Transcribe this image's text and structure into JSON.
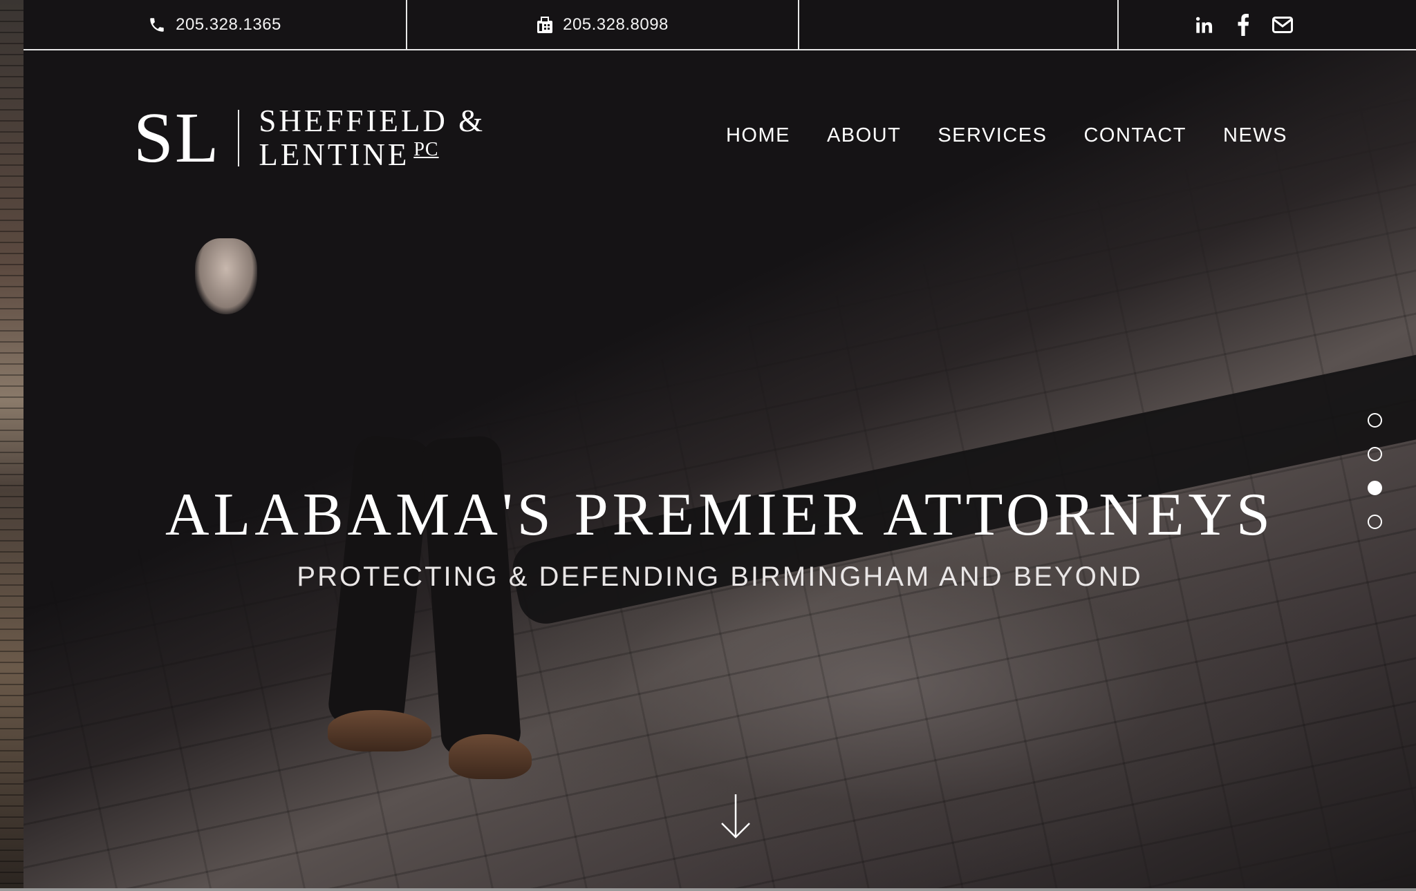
{
  "topbar": {
    "phone": "205.328.1365",
    "fax": "205.328.8098",
    "social": [
      "linkedin-icon",
      "facebook-icon",
      "envelope-icon"
    ]
  },
  "logo": {
    "initials": "SL",
    "line1": "SHEFFIELD &",
    "line2": "LENTINE",
    "suffix": "PC"
  },
  "nav": {
    "items": [
      {
        "label": "HOME"
      },
      {
        "label": "ABOUT"
      },
      {
        "label": "SERVICES"
      },
      {
        "label": "CONTACT"
      },
      {
        "label": "NEWS"
      }
    ]
  },
  "hero": {
    "headline": "ALABAMA'S PREMIER ATTORNEYS",
    "subheadline": "PROTECTING & DEFENDING BIRMINGHAM AND BEYOND",
    "slides_total": 4,
    "active_slide": 3
  },
  "colors": {
    "background": "#151315",
    "text": "#ffffff",
    "divider": "#e8e8e8"
  }
}
